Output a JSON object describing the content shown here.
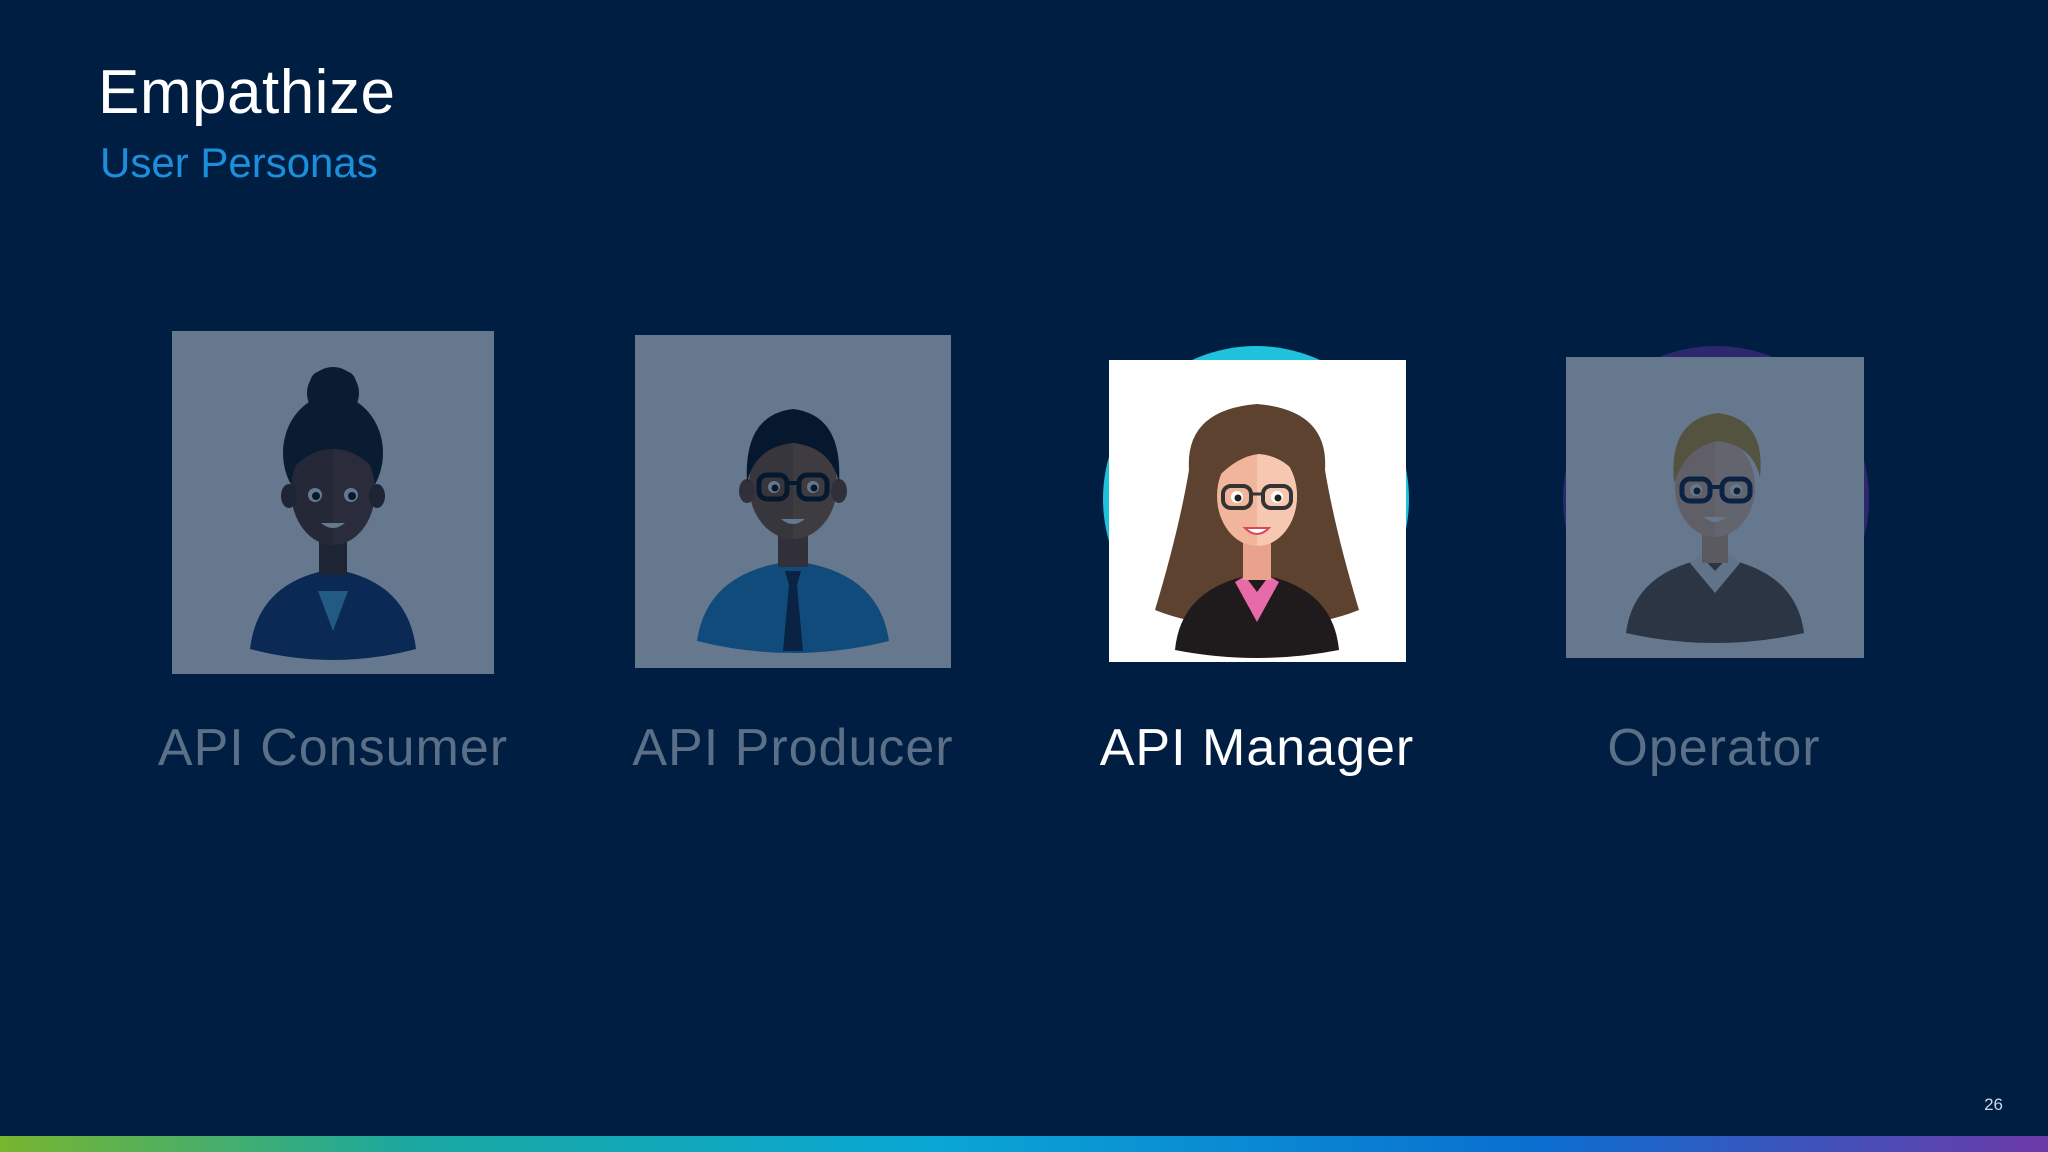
{
  "slide": {
    "title": "Empathize",
    "subtitle": "User Personas",
    "page_number": "26"
  },
  "personas": [
    {
      "label": "API Consumer",
      "state": "dimmed",
      "icon": "woman-dark-hair-bun-avatar-icon"
    },
    {
      "label": "API Producer",
      "state": "dimmed",
      "icon": "man-glasses-tie-avatar-icon"
    },
    {
      "label": "API Manager",
      "state": "active",
      "icon": "woman-long-hair-glasses-avatar-icon"
    },
    {
      "label": "Operator",
      "state": "dimmed",
      "icon": "man-blond-glasses-avatar-icon"
    }
  ],
  "colors": {
    "background": "#001e42",
    "title": "#ffffff",
    "subtitle": "#1b8fdc",
    "dimmed_label": "#5b6f87",
    "active_label": "#ffffff",
    "active_halo": "#1ec2dc",
    "operator_halo": "#4b2f8a"
  }
}
